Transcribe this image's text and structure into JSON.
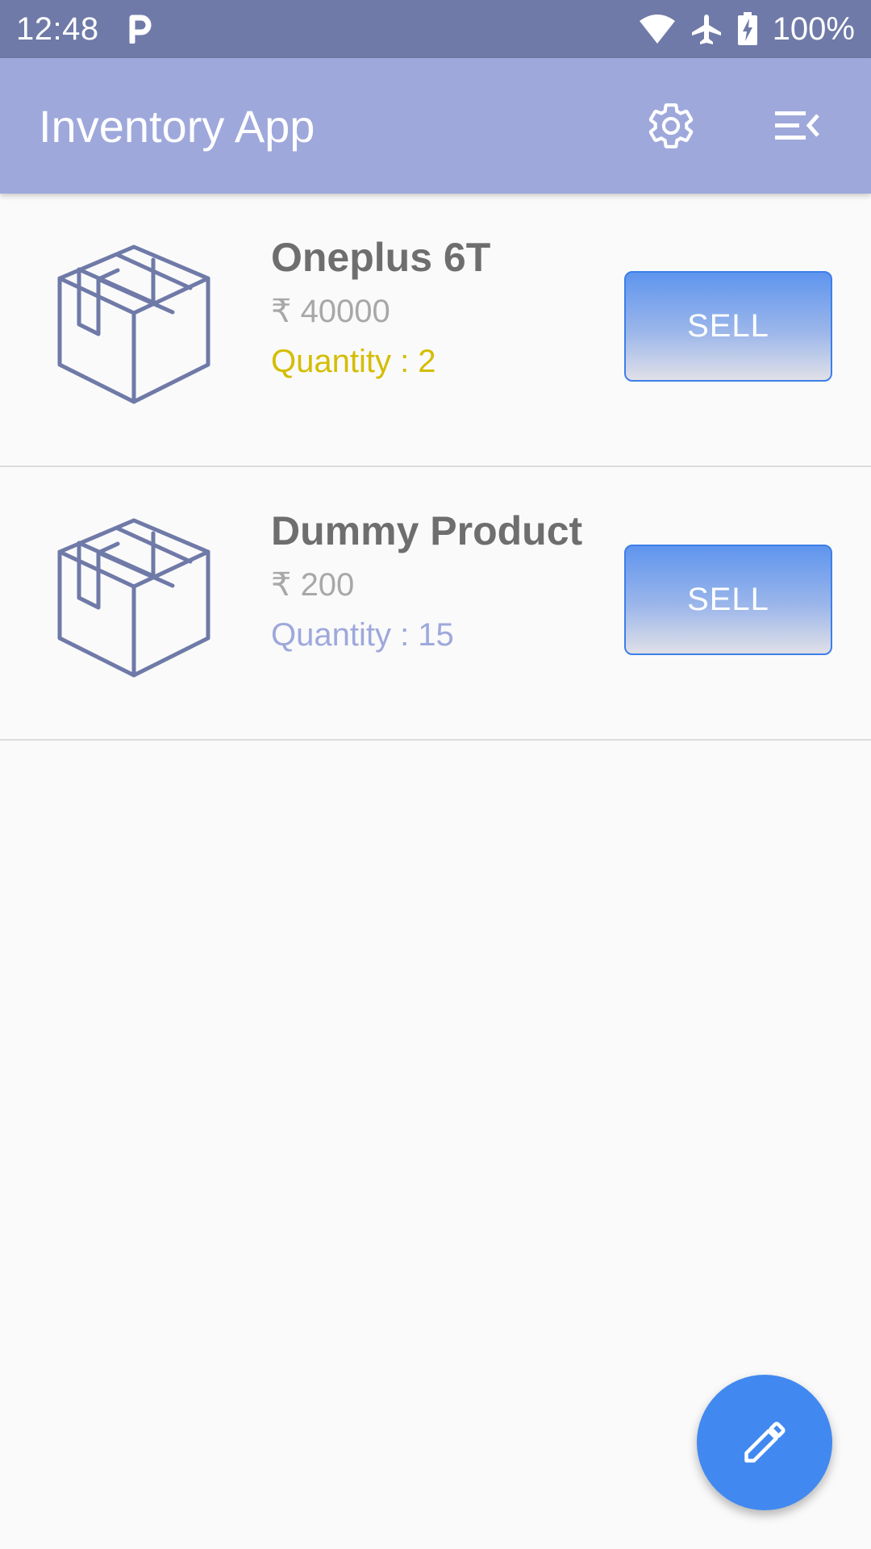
{
  "status_bar": {
    "time": "12:48",
    "battery": "100%",
    "icons": [
      "parking-icon",
      "wifi-icon",
      "airplane-icon",
      "battery-charging-icon"
    ]
  },
  "app_bar": {
    "title": "Inventory App",
    "actions": [
      "settings-icon",
      "menu-collapse-icon"
    ]
  },
  "products": [
    {
      "name": "Oneplus 6T",
      "price": "₹ 40000",
      "quantity": "Quantity : 2",
      "quantity_color": "#d4bd00",
      "sell_label": "SELL",
      "icon": "box-icon"
    },
    {
      "name": "Dummy Product",
      "price": "₹ 200",
      "quantity": "Quantity : 15",
      "quantity_color": "#9ea8db",
      "sell_label": "SELL",
      "icon": "box-icon"
    }
  ],
  "fab": {
    "icon": "edit-pencil-icon"
  },
  "colors": {
    "status_bar": "#6f7aa8",
    "app_bar": "#9ea8db",
    "accent": "#4189f0",
    "icon_stroke": "#6f7aa8"
  }
}
